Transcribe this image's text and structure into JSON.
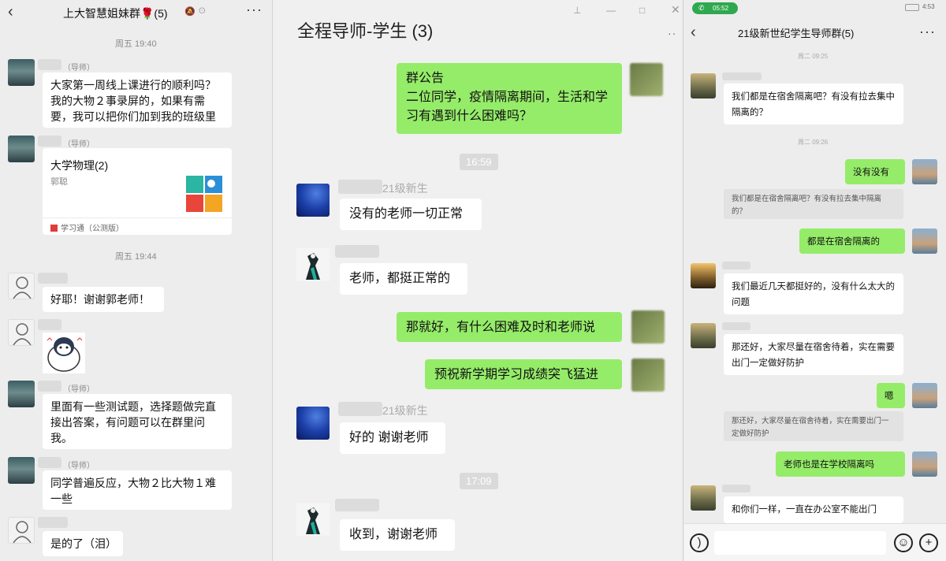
{
  "left_panel": {
    "title": "上大智慧姐妹群🌹(5)",
    "time_1": "周五 19:40",
    "time_2": "周五 19:44",
    "tutor_tag": "（导师）",
    "messages": [
      {
        "text": "大家第一周线上课进行的顺利吗？我的大物２事录屏的，如果有需要，我可以把你们加到我的班级里"
      },
      {
        "text": "好耶！谢谢郭老师！"
      },
      {
        "text": "里面有一些测试题，选择题做完直接出答案，有问题可以在群里问我。"
      },
      {
        "text": "同学普遍反应，大物２比大物１难一些"
      },
      {
        "text": "是的了（泪）"
      }
    ],
    "card": {
      "title": "大学物理(2)",
      "subtitle": "郭聪",
      "footer": "学习通（公测版）"
    }
  },
  "middle_panel": {
    "title": "全程导师-学生 (3)",
    "time_1": "16:59",
    "time_2": "17:09",
    "sender_suffix": "21级新生",
    "messages": [
      {
        "text": "群公告\n二位同学，疫情隔离期间，生活和学习有遇到什么困难吗？"
      },
      {
        "text": "没有的老师一切正常"
      },
      {
        "text": "老师，都挺正常的"
      },
      {
        "text": "那就好，有什么困难及时和老师说"
      },
      {
        "text": "预祝新学期学习成绩突飞猛进"
      },
      {
        "text": "好的 谢谢老师"
      },
      {
        "text": "收到，谢谢老师"
      }
    ]
  },
  "right_panel": {
    "title": "21级新世纪学生导师群(5)",
    "status_time": "05:52",
    "status_right": "4:53",
    "time_1": "周二 09:25",
    "time_2": "周二 09:26",
    "messages": [
      {
        "text": "我们都是在宿舍隔离吧？有没有拉去集中隔离的？"
      },
      {
        "text": "没有没有"
      },
      {
        "text": "我们都是在宿舍隔离吧？有没有拉去集中隔离的？"
      },
      {
        "text": "都是在宿舍隔离的"
      },
      {
        "text": "我们最近几天都挺好的，没有什么太大的问题"
      },
      {
        "text": "那还好，大家尽量在宿舍待着，实在需要出门一定做好防护"
      },
      {
        "text": "嗯"
      },
      {
        "text": "那还好，大家尽量在宿舍待着，实在需要出门一定做好防护"
      },
      {
        "text": "老师也是在学校隔离吗"
      },
      {
        "text": "和你们一样，一直在办公室不能出门"
      }
    ]
  },
  "icons": {
    "back": "back-arrow-icon",
    "more": "more-dots-icon",
    "voice": "voice-icon",
    "emoji": "emoji-icon",
    "plus": "plus-icon"
  },
  "colors": {
    "green_bubble": "#95ec69",
    "white_bubble": "#ffffff",
    "background": "#ededed"
  }
}
